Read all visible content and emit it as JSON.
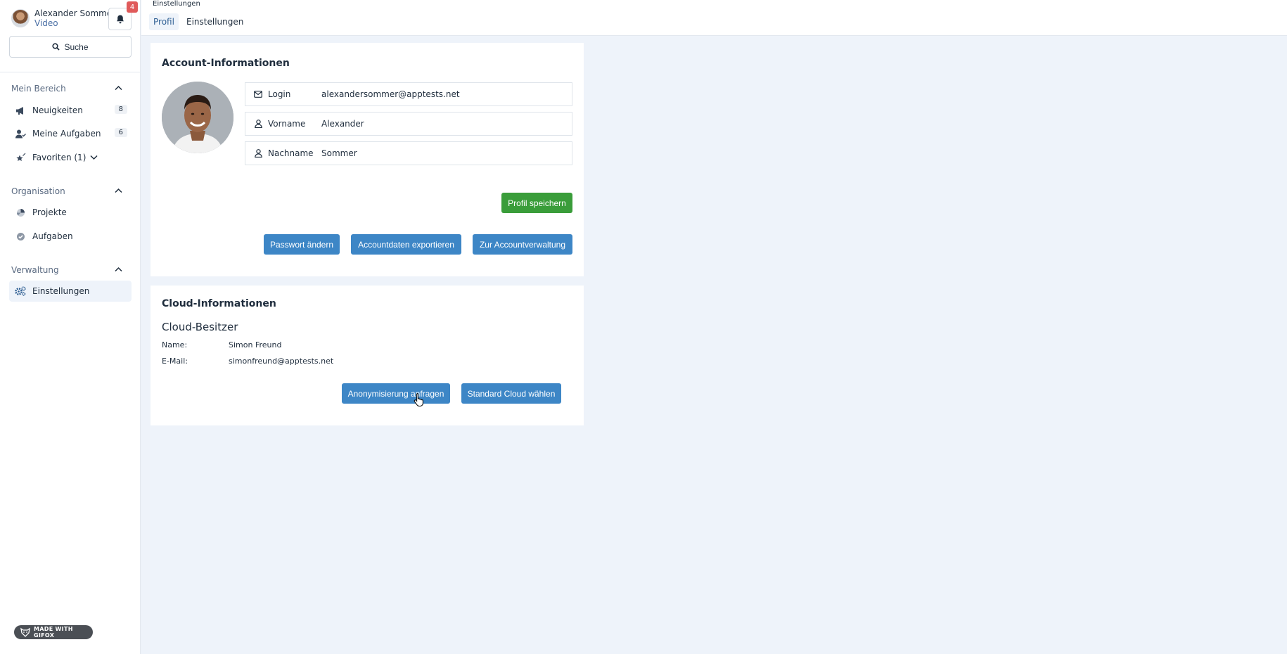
{
  "user": {
    "name": "Alexander Sommer",
    "subtitle": "Video",
    "notification_count": "4"
  },
  "search": {
    "label": "Suche"
  },
  "sidebar": {
    "sections": [
      {
        "title": "Mein Bereich",
        "items": [
          {
            "label": "Neuigkeiten",
            "count": "8",
            "icon": "megaphone-icon"
          },
          {
            "label": "Meine Aufgaben",
            "count": "6",
            "icon": "user-check-icon"
          },
          {
            "label": "Favoriten (1)",
            "icon": "star-icon"
          }
        ]
      },
      {
        "title": "Organisation",
        "items": [
          {
            "label": "Projekte",
            "icon": "pie-chart-icon"
          },
          {
            "label": "Aufgaben",
            "icon": "check-circle-icon"
          }
        ]
      },
      {
        "title": "Verwaltung",
        "items": [
          {
            "label": "Einstellungen",
            "icon": "gears-icon",
            "active": true
          }
        ]
      }
    ]
  },
  "gifox": {
    "label": "MADE WITH GIFOX"
  },
  "header": {
    "breadcrumb": "Einstellungen",
    "tabs": [
      {
        "label": "Profil",
        "active": true
      },
      {
        "label": "Einstellungen"
      }
    ]
  },
  "account": {
    "title": "Account-Informationen",
    "fields": [
      {
        "label": "Login",
        "value": "alexandersommer@apptests.net",
        "icon": "envelope-icon"
      },
      {
        "label": "Vorname",
        "value": "Alexander",
        "icon": "person-icon"
      },
      {
        "label": "Nachname",
        "value": "Sommer",
        "icon": "person-icon"
      }
    ],
    "save_label": "Profil speichern",
    "actions": [
      "Passwort ändern",
      "Accountdaten exportieren",
      "Zur Accountverwaltung"
    ]
  },
  "cloud": {
    "title": "Cloud-Informationen",
    "owner_title": "Cloud-Besitzer",
    "name_label": "Name:",
    "name_value": "Simon Freund",
    "email_label": "E-Mail:",
    "email_value": "simonfreund@apptests.net",
    "actions": [
      "Anonymisierung anfragen",
      "Standard Cloud wählen"
    ]
  },
  "colors": {
    "primary": "#3d86c6",
    "success": "#3a9d3a",
    "badge": "#e05a5a",
    "background": "#eef3fa"
  }
}
